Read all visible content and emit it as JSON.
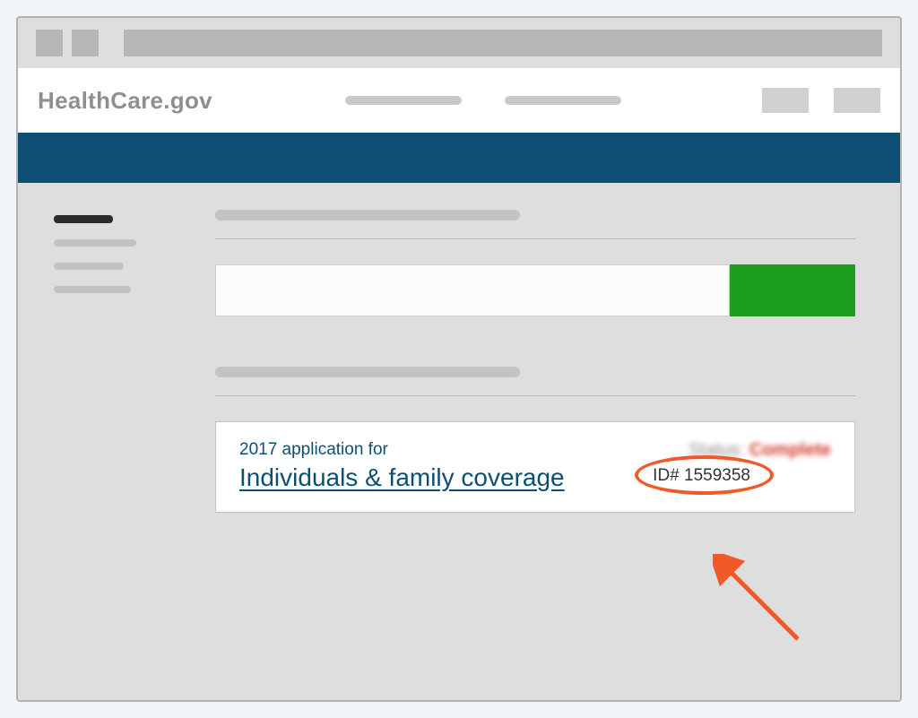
{
  "header": {
    "brand": "HealthCare.gov"
  },
  "application": {
    "year_line": "2017 application for",
    "title": "Individuals & family coverage",
    "status_label": "Status:",
    "status_value": "Complete",
    "id_label": "ID# 1559358"
  }
}
